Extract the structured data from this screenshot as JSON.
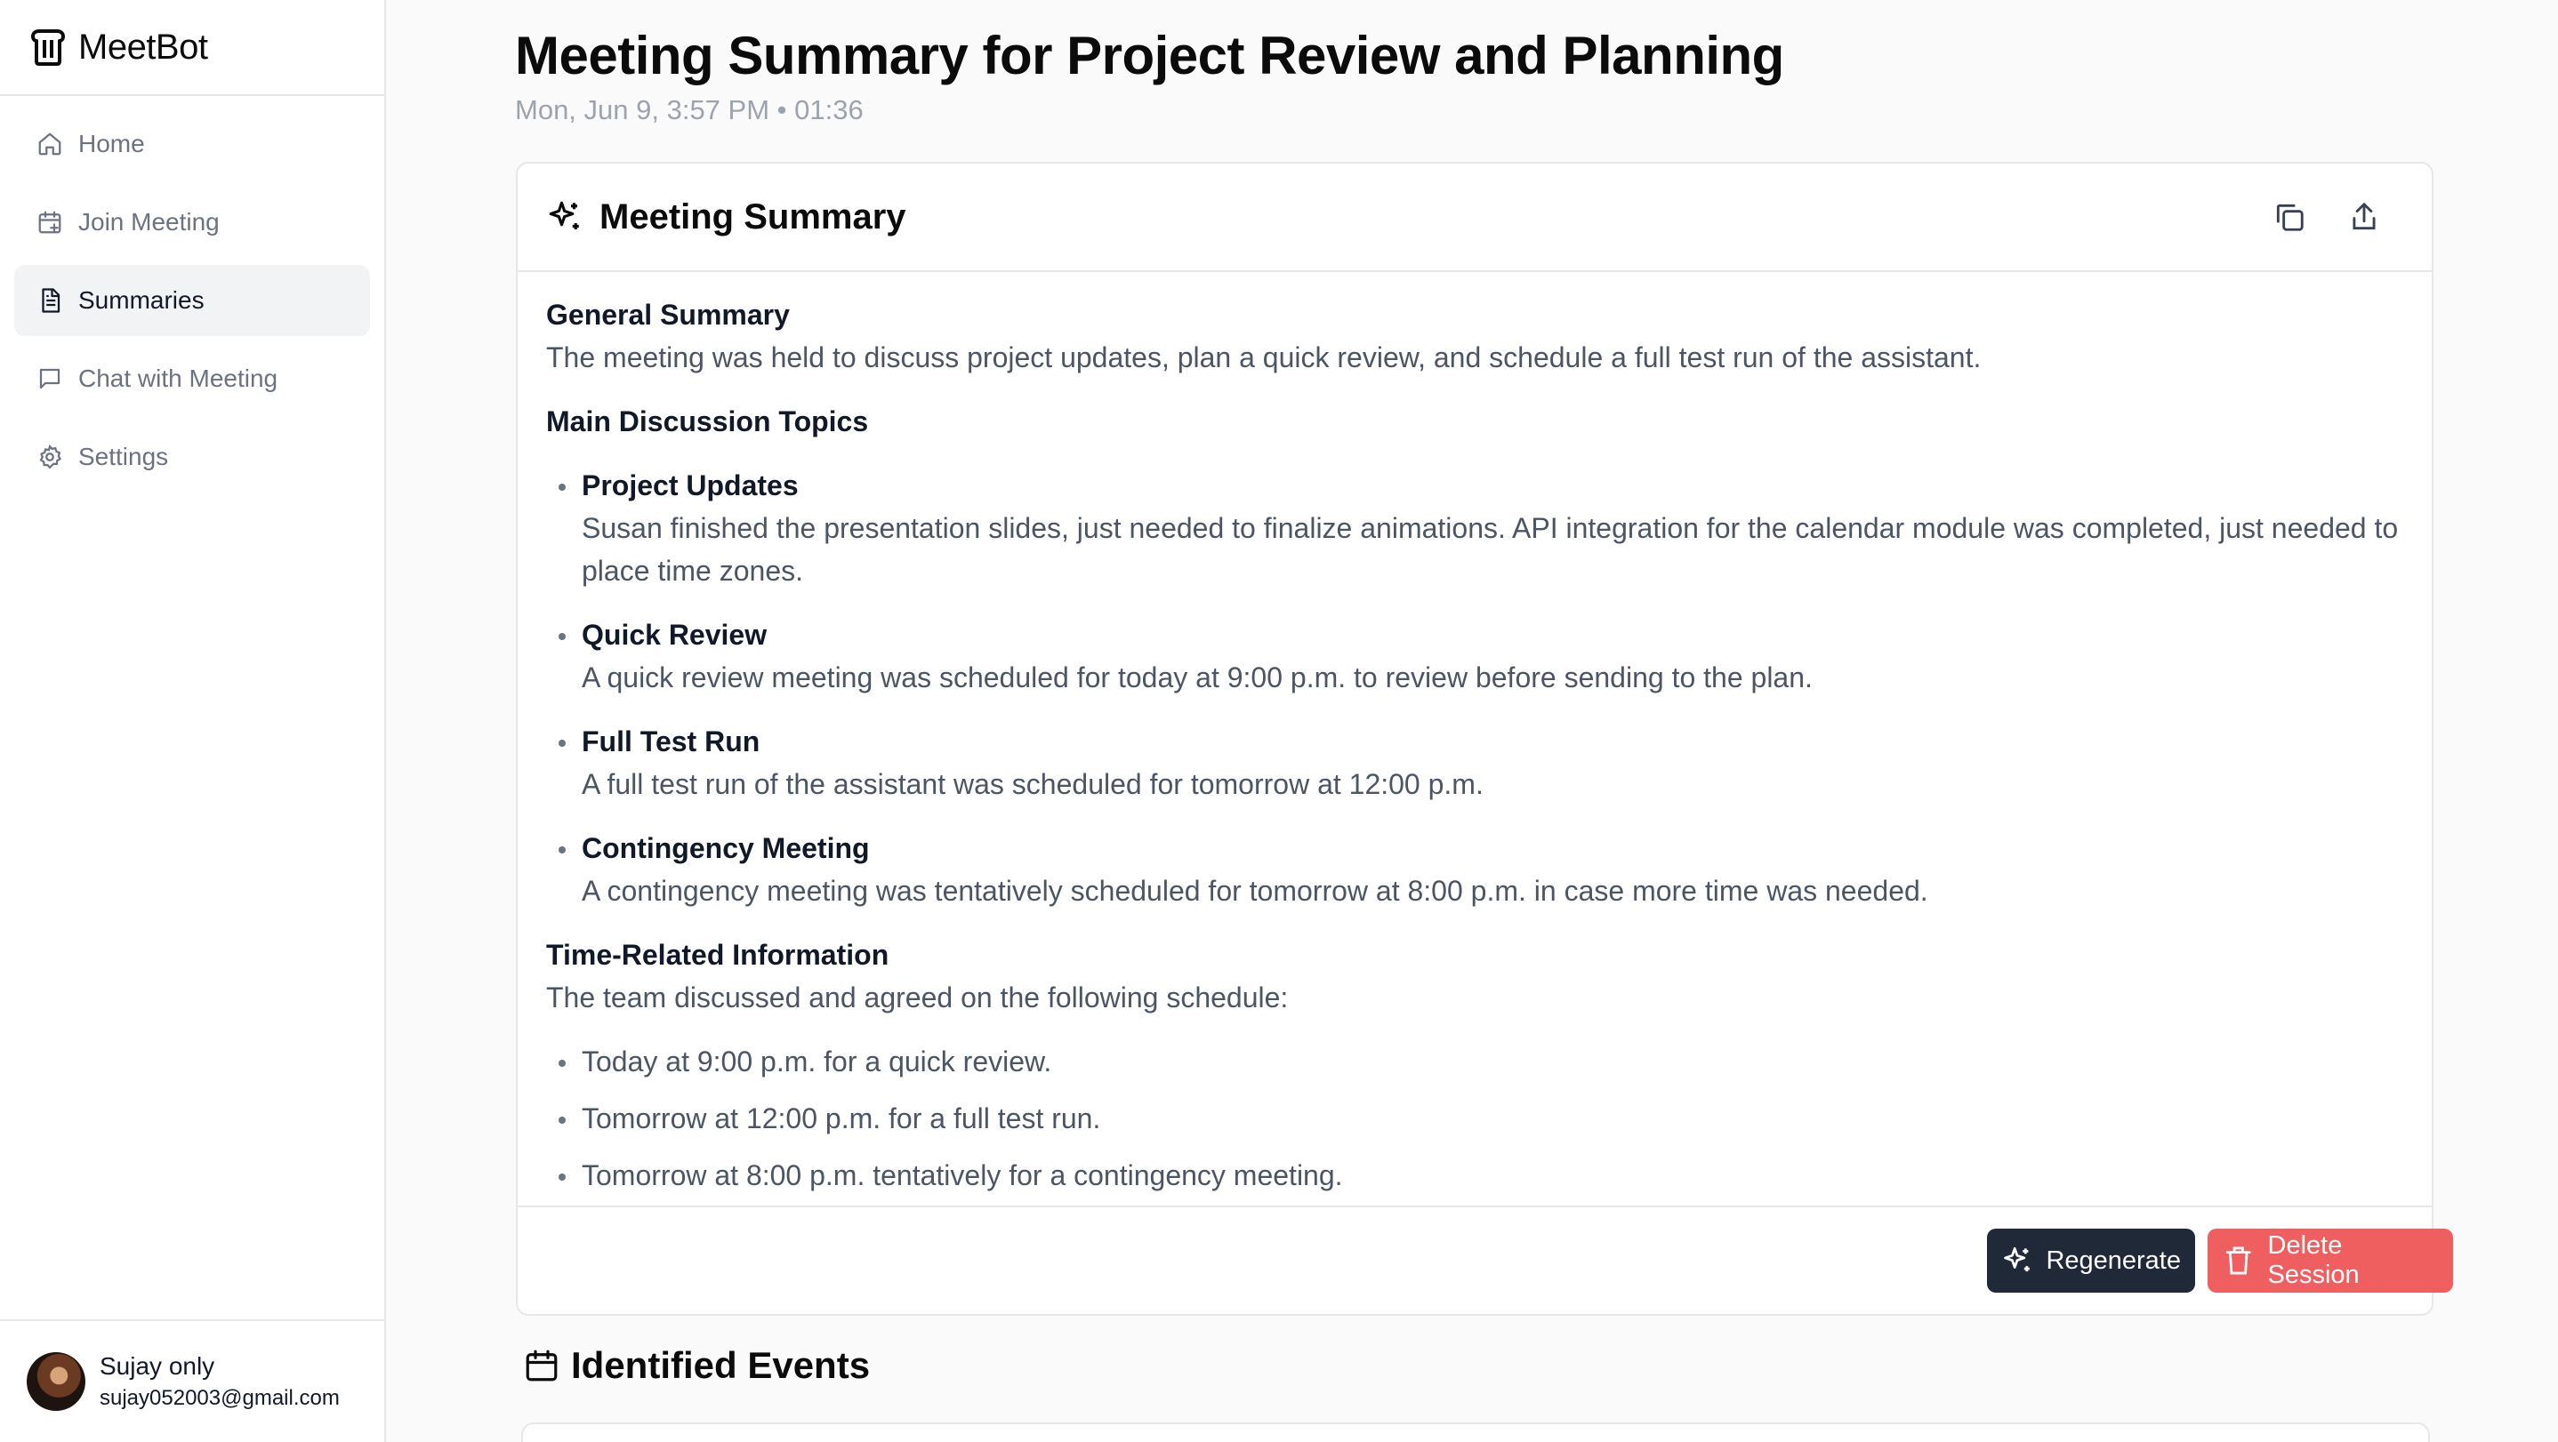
{
  "app": {
    "name": "MeetBot"
  },
  "sidebar": {
    "items": [
      {
        "label": "Home",
        "icon": "home-icon"
      },
      {
        "label": "Join Meeting",
        "icon": "calendar-plus-icon"
      },
      {
        "label": "Summaries",
        "icon": "document-icon",
        "active": true
      },
      {
        "label": "Chat with Meeting",
        "icon": "chat-icon"
      },
      {
        "label": "Settings",
        "icon": "gear-icon"
      }
    ]
  },
  "user": {
    "name": "Sujay only",
    "email": "sujay052003@gmail.com"
  },
  "page": {
    "title": "Meeting Summary for Project Review and Planning",
    "meta": "Mon, Jun 9, 3:57 PM • 01:36"
  },
  "summary": {
    "card_title": "Meeting Summary",
    "general_heading": "General Summary",
    "general_text": "The meeting was held to discuss project updates, plan a quick review, and schedule a full test run of the assistant.",
    "topics_heading": "Main Discussion Topics",
    "topics": [
      {
        "title": "Project Updates",
        "text": "Susan finished the presentation slides, just needed to finalize animations. API integration for the calendar module was completed, just needed to place time zones."
      },
      {
        "title": "Quick Review",
        "text": "A quick review meeting was scheduled for today at 9:00 p.m. to review before sending to the plan."
      },
      {
        "title": "Full Test Run",
        "text": "A full test run of the assistant was scheduled for tomorrow at 12:00 p.m."
      },
      {
        "title": "Contingency Meeting",
        "text": "A contingency meeting was tentatively scheduled for tomorrow at 8:00 p.m. in case more time was needed."
      }
    ],
    "time_heading": "Time-Related Information",
    "time_text": "The team discussed and agreed on the following schedule:",
    "schedule": [
      "Today at 9:00 p.m. for a quick review.",
      "Tomorrow at 12:00 p.m. for a full test run.",
      "Tomorrow at 8:00 p.m. tentatively for a contingency meeting."
    ],
    "regenerate_label": "Regenerate",
    "delete_label": "Delete Session"
  },
  "events": {
    "title": "Identified Events"
  },
  "colors": {
    "accent_dark": "#1f2937",
    "danger": "#ef5f5f",
    "active_bg": "#f2f3f5"
  }
}
